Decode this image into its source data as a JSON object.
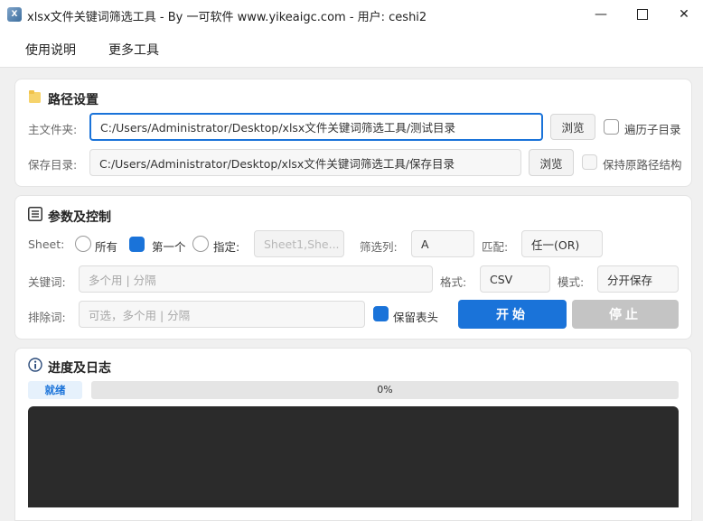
{
  "window": {
    "title": "xlsx文件关键词筛选工具 - By 一可软件 www.yikeaigc.com - 用户: ceshi2",
    "minimize": "—",
    "close": "✕"
  },
  "menu": {
    "items": [
      "使用说明",
      "更多工具"
    ]
  },
  "path_settings": {
    "title": "路径设置",
    "main_folder_label": "主文件夹:",
    "main_folder_value": "C:/Users/Administrator/Desktop/xlsx文件关键词筛选工具/测试目录",
    "browse1": "浏览",
    "traverse_subdirs_label": "遍历子目录",
    "traverse_subdirs_checked": false,
    "save_dir_label": "保存目录:",
    "save_dir_value": "C:/Users/Administrator/Desktop/xlsx文件关键词筛选工具/保存目录",
    "browse2": "浏览",
    "keep_structure_label": "保持原路径结构",
    "keep_structure_checked": false
  },
  "params": {
    "title": "参数及控制",
    "sheet_label": "Sheet:",
    "sheet_options": [
      "所有",
      "第一个",
      "指定:"
    ],
    "sheet_selected": "第一个",
    "sheet_specify_placeholder": "Sheet1,She...",
    "filter_col_label": "筛选列:",
    "filter_col_value": "A",
    "match_label": "匹配:",
    "match_value": "任一(OR)",
    "keywords_label": "关键词:",
    "keywords_placeholder": "多个用 | 分隔",
    "format_label": "格式:",
    "format_value": "CSV",
    "mode_label": "模式:",
    "mode_value": "分开保存",
    "exclude_label": "排除词:",
    "exclude_placeholder": "可选，多个用 | 分隔",
    "keep_header_label": "保留表头",
    "keep_header_checked": true,
    "start_label": "开始",
    "stop_label": "停止"
  },
  "progress": {
    "title": "进度及日志",
    "status": "就绪",
    "percent": 0,
    "percent_text": "0%"
  },
  "colors": {
    "accent": "#1a73d9",
    "stop_disabled": "#c4c4c4",
    "log_bg": "#2b2b2b"
  }
}
